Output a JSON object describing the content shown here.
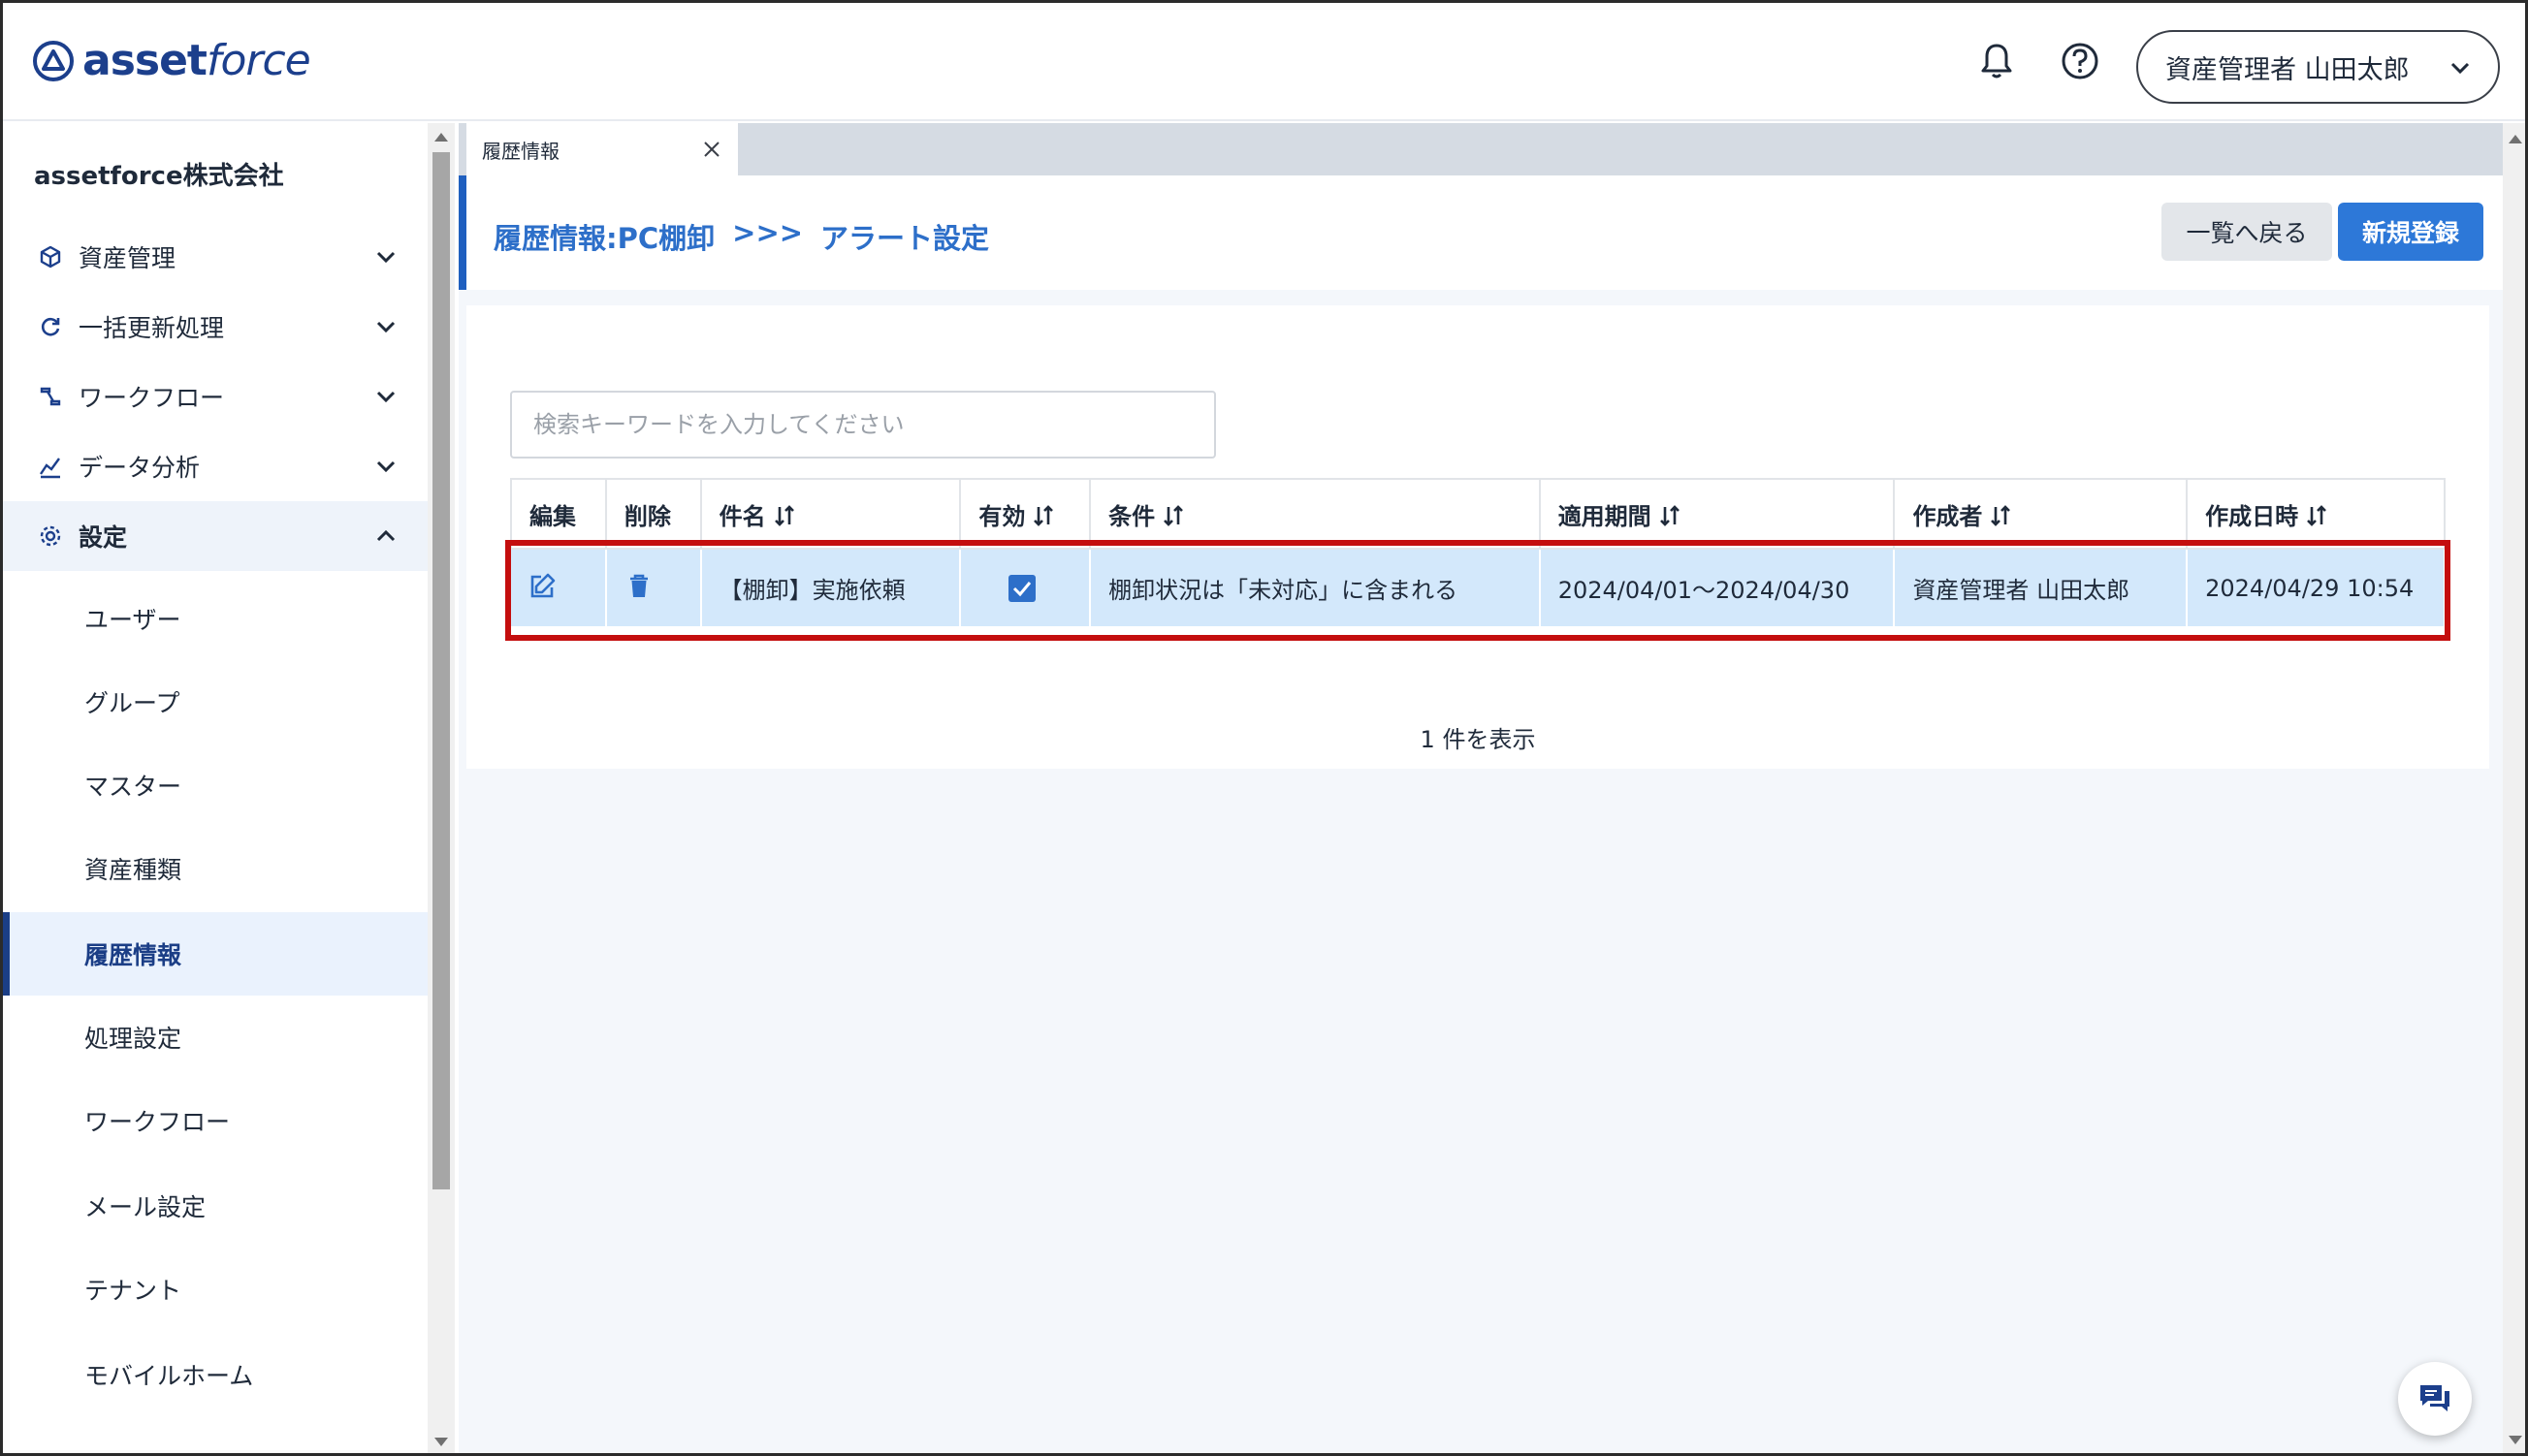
{
  "header": {
    "logo_bold": "asset",
    "logo_light": "force",
    "user_label": "資産管理者 山田太郎"
  },
  "sidebar": {
    "company": "assetforce株式会社",
    "menu": [
      {
        "label": "資産管理",
        "icon": "cube-icon"
      },
      {
        "label": "一括更新処理",
        "icon": "refresh-icon"
      },
      {
        "label": "ワークフロー",
        "icon": "workflow-icon"
      },
      {
        "label": "データ分析",
        "icon": "analytics-icon"
      },
      {
        "label": "設定",
        "icon": "gear-icon"
      }
    ],
    "sub": [
      {
        "label": "ユーザー"
      },
      {
        "label": "グループ"
      },
      {
        "label": "マスター"
      },
      {
        "label": "資産種類"
      },
      {
        "label": "履歴情報"
      },
      {
        "label": "処理設定"
      },
      {
        "label": "ワークフロー"
      },
      {
        "label": "メール設定"
      },
      {
        "label": "テナント"
      },
      {
        "label": "モバイルホーム"
      }
    ]
  },
  "tab": {
    "label": "履歴情報"
  },
  "title": {
    "crumb1": "履歴情報:PC棚卸",
    "sep": ">>>",
    "crumb2": "アラート設定",
    "back_label": "一覧へ戻る",
    "new_label": "新規登録"
  },
  "search": {
    "placeholder": "検索キーワードを入力してください"
  },
  "table": {
    "headers": [
      "編集",
      "削除",
      "件名",
      "有効",
      "条件",
      "適用期間",
      "作成者",
      "作成日時"
    ],
    "rows": [
      {
        "subject": "【棚卸】実施依頼",
        "enabled": true,
        "condition": "棚卸状況は「未対応」に含まれる",
        "period": "2024/04/01〜2024/04/30",
        "creator": "資産管理者 山田太郎",
        "created": "2024/04/29 10:54"
      }
    ]
  },
  "count": "1 件を表示",
  "colors": {
    "brand": "#1c3f8c",
    "accent": "#2d78d8",
    "row_bg": "#d3e8fb",
    "highlight": "#c40e0e"
  }
}
